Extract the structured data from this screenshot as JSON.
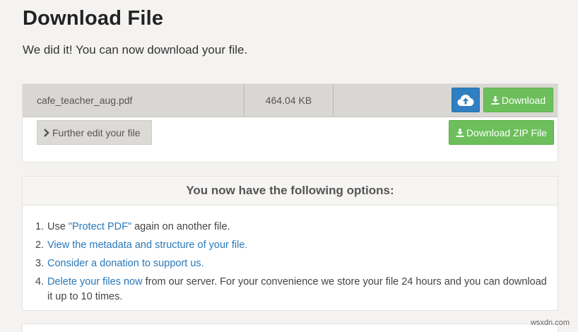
{
  "header": {
    "title": "Download File",
    "subtitle": "We did it! You can now download your file."
  },
  "file": {
    "name": "cafe_teacher_aug.pdf",
    "size": "464.04 KB",
    "upload_icon": "cloud-upload-icon",
    "download_label": "Download",
    "download_zip_label": "Download ZIP File",
    "edit_label": "Further edit your file"
  },
  "options": {
    "heading": "You now have the following options:",
    "items": [
      {
        "num": "1.",
        "prefix": "Use ",
        "link": "\"Protect PDF\"",
        "suffix": " again on another file."
      },
      {
        "num": "2.",
        "prefix": "",
        "link": "View the metadata and structure of your file.",
        "suffix": ""
      },
      {
        "num": "3.",
        "prefix": "",
        "link": "Consider a donation to support us.",
        "suffix": ""
      },
      {
        "num": "4.",
        "prefix": "",
        "link": "Delete your files now",
        "suffix": " from our server. For your convenience we store your file 24 hours and you can download it up to 10 times."
      }
    ]
  },
  "watermark": "wsxdn.com",
  "colors": {
    "primary_blue": "#2f7fc1",
    "success_green": "#6cbf5a",
    "link_blue": "#2a78b8",
    "file_row_bg": "#d9d7d3"
  }
}
